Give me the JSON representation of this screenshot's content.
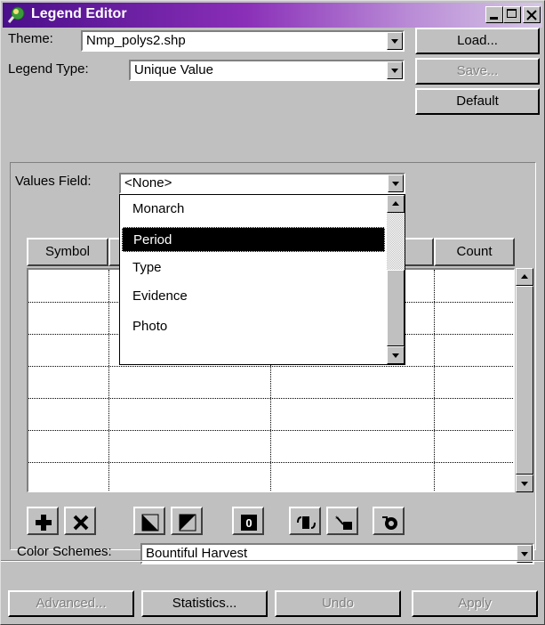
{
  "window": {
    "title": "Legend Editor",
    "app_icon": "globe-magnifier-icon"
  },
  "theme": {
    "label": "Theme:",
    "value": "Nmp_polys2.shp"
  },
  "legend_type": {
    "label": "Legend Type:",
    "value": "Unique Value"
  },
  "buttons": {
    "load": "Load...",
    "save": "Save...",
    "default": "Default"
  },
  "values_field": {
    "label": "Values Field:",
    "value": "<None>",
    "options": [
      "Monarch",
      "Period",
      "Type",
      "Evidence",
      "Photo"
    ],
    "highlighted": "Period"
  },
  "table": {
    "columns": [
      "Symbol",
      "Count"
    ],
    "rows": 7
  },
  "toolbar_icons": [
    "add-icon",
    "delete-icon",
    "move-down-icon",
    "move-up-icon",
    "zero-icon",
    "swap-symbols-icon",
    "sort-icon",
    "refresh-icon"
  ],
  "color_schemes": {
    "label": "Color Schemes:",
    "value": "Bountiful Harvest"
  },
  "bottom_buttons": {
    "advanced": "Advanced...",
    "statistics": "Statistics...",
    "undo": "Undo",
    "apply": "Apply"
  },
  "colors": {
    "title_start": "#4a0f8a",
    "title_end": "#d6c7e6",
    "face": "#c0c0c0"
  }
}
